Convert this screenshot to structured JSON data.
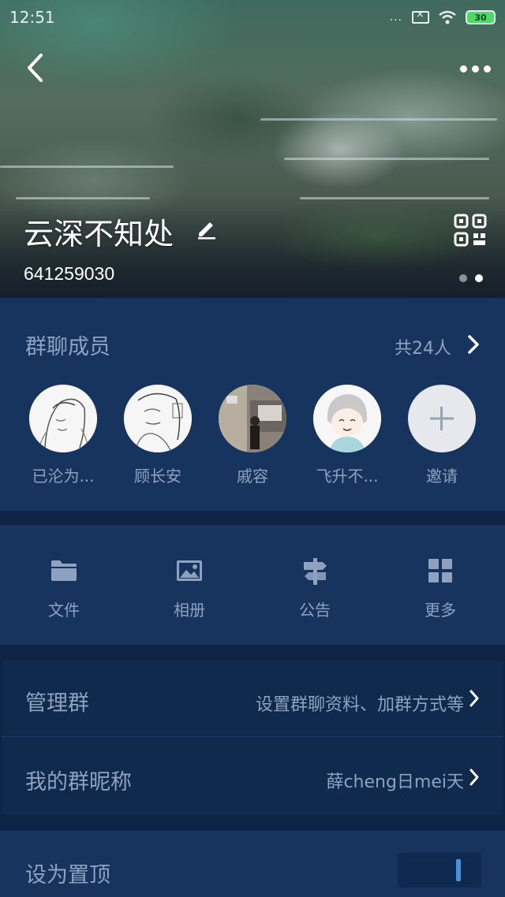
{
  "status_bar": {
    "time": "12:51",
    "signal": "...",
    "battery": "30"
  },
  "header": {
    "group_name": "云深不知处",
    "group_id": "641259030",
    "pager_pages": 2,
    "pager_active": 2
  },
  "members": {
    "title": "群聊成员",
    "count": "共24人",
    "items": [
      {
        "name": "已沦为..."
      },
      {
        "name": "顾长安"
      },
      {
        "name": "戚容"
      },
      {
        "name": "飞升不..."
      },
      {
        "name": "邀请"
      }
    ]
  },
  "actions": {
    "items": [
      {
        "label": "文件",
        "icon": "folder-icon"
      },
      {
        "label": "相册",
        "icon": "image-icon"
      },
      {
        "label": "公告",
        "icon": "signpost-icon"
      },
      {
        "label": "更多",
        "icon": "grid-icon"
      }
    ]
  },
  "settings": {
    "manage_label": "管理群",
    "manage_value": "设置群聊资料、加群方式等",
    "nickname_label": "我的群昵称",
    "nickname_value": "薛cheng日mei天",
    "pin_label": "设为置顶",
    "pin_on": false
  },
  "colors": {
    "background": "#0f2344",
    "panel": "#17345f",
    "text_muted": "#8ea2c0",
    "accent": "#4a90e2"
  }
}
